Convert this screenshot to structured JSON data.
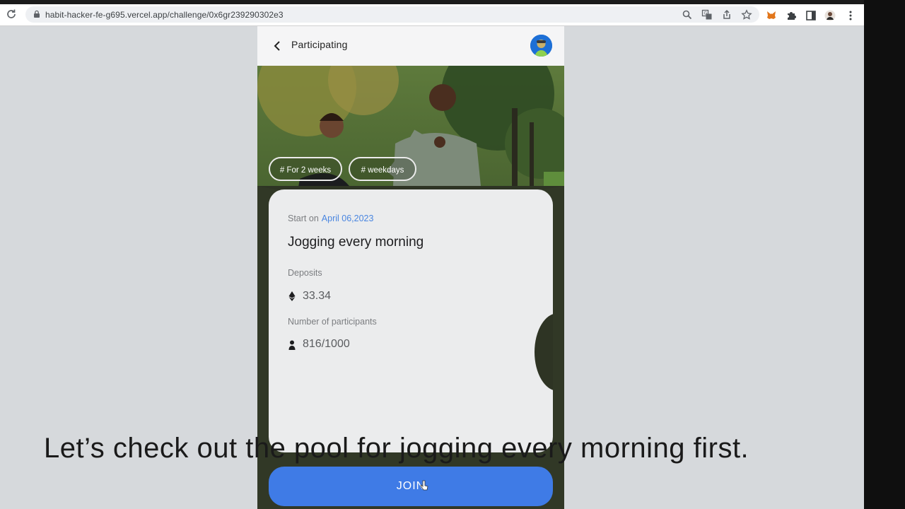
{
  "browser": {
    "url": "habit-hacker-fe-g695.vercel.app/challenge/0x6gr239290302e3",
    "icons": [
      "reload-icon",
      "lock-icon",
      "search-icon",
      "translate-icon",
      "share-icon",
      "star-icon",
      "metamask-fox-icon",
      "puzzle-extension-icon",
      "sidebar-icon",
      "profile-icon",
      "more-icon"
    ]
  },
  "app": {
    "header": {
      "title": "Participating",
      "back_icon": "chevron-left-icon",
      "avatar_icon": "avatar"
    },
    "tags": [
      "# For 2 weeks",
      "# weekdays"
    ],
    "card": {
      "start_label": "Start on",
      "start_date": "April 06,2023",
      "title": "Jogging every morning",
      "deposits_label": "Deposits",
      "deposits_value": "33.34",
      "participants_label": "Number of participants",
      "participants_value": "816/1000"
    },
    "join_label": "JOIN"
  },
  "caption": "Let’s check out the pool for jogging every morning first.",
  "colors": {
    "accent": "#3f7be6",
    "date": "#4a86e0",
    "card": "#ebeced",
    "page_bg": "#d6d9dc"
  }
}
